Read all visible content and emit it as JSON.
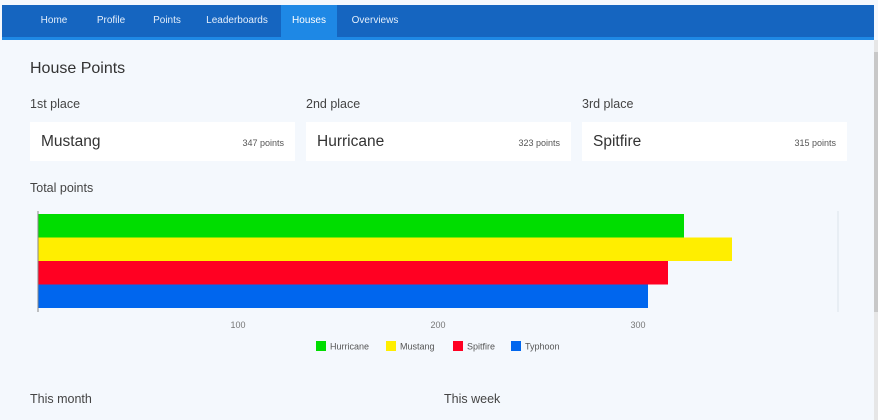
{
  "nav": {
    "items": [
      {
        "label": "Home"
      },
      {
        "label": "Profile"
      },
      {
        "label": "Points"
      },
      {
        "label": "Leaderboards"
      },
      {
        "label": "Houses"
      },
      {
        "label": "Overviews"
      }
    ],
    "active": "Houses"
  },
  "page": {
    "title": "House Points"
  },
  "places": [
    {
      "label": "1st place",
      "house": "Mustang",
      "points": "347 points"
    },
    {
      "label": "2nd place",
      "house": "Hurricane",
      "points": "323 points"
    },
    {
      "label": "3rd place",
      "house": "Spitfire",
      "points": "315 points"
    }
  ],
  "sections": {
    "total": "Total points",
    "month": "This month",
    "week": "This week"
  },
  "chart_data": {
    "type": "bar",
    "orientation": "horizontal",
    "title": "",
    "xlabel": "",
    "ylabel": "",
    "xlim": [
      0,
      400
    ],
    "ticks": [
      100,
      200,
      300
    ],
    "tick_labels": [
      "100",
      "200",
      "300"
    ],
    "grid": false,
    "legend_position": "bottom",
    "series": [
      {
        "name": "Hurricane",
        "value": 323,
        "color": "#00dd00"
      },
      {
        "name": "Mustang",
        "value": 347,
        "color": "#ffee00"
      },
      {
        "name": "Spitfire",
        "value": 315,
        "color": "#ff0022"
      },
      {
        "name": "Typhoon",
        "value": 305,
        "color": "#0066ee"
      }
    ]
  }
}
